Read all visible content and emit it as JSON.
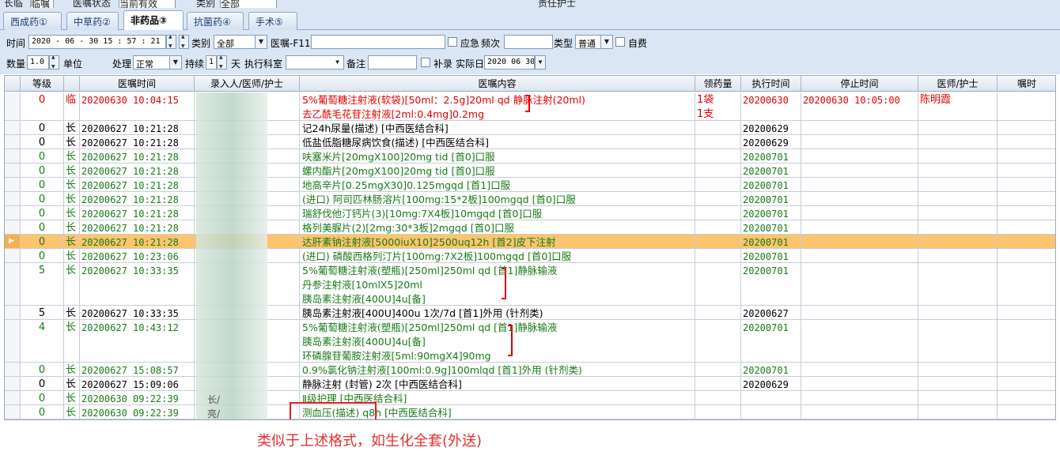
{
  "top_strip": [
    "长临",
    "临嘱",
    "医嘱状态",
    "当前有效",
    "类别",
    "全部",
    "责任护士"
  ],
  "tabs": [
    "西成药①",
    "中草药②",
    "非药品③",
    "抗菌药④",
    "手术⑤"
  ],
  "active_tab": 2,
  "toolbar": {
    "time_label": "时间",
    "time_value": "2020 - 06 - 30   15 : 57 : 21",
    "category_label": "类别",
    "category_value": "全部",
    "order_label": "医嘱-F11",
    "urgent_label": "应急",
    "freq_label": "频次",
    "type_label": "类型",
    "type_value": "普通",
    "selfpay_label": "自费",
    "qty_label": "数量",
    "qty_value": "1.0",
    "unit_label": "单位",
    "handle_label": "处理",
    "handle_value": "正常",
    "continue_label": "持续",
    "continue_value": "1",
    "days_label": "天",
    "exec_dept_label": "执行科室",
    "remark_label": "备注",
    "supp_label": "补录",
    "actual_day_label": "实际日",
    "actual_day_value": "2020 06 30"
  },
  "columns": [
    "等级",
    "医嘱时间",
    "录入人/医师/护士",
    "医嘱内容",
    "领药量",
    "执行时间",
    "停止时间",
    "医师/护士",
    "嘱时"
  ],
  "rows": [
    {
      "level": "0",
      "type": "临",
      "time": "20200630 10:04:15",
      "content": [
        "5%葡萄糖注射液(软袋)[50ml：2.5g]20ml qd 静脉注射(20ml)",
        "去乙酰毛花苷注射液[2ml:0.4mg]0.2mg"
      ],
      "qty": [
        "1袋",
        "1支"
      ],
      "exec": "20200630",
      "stop": "20200630 10:05:00",
      "doctor": "陈明霞",
      "color": "#e00000"
    },
    {
      "level": "0",
      "type": "长",
      "time": "20200627 10:21:28",
      "content": [
        "记24h尿量(描述)    [中西医结合科]"
      ],
      "qty": [],
      "exec": "20200629",
      "stop": "",
      "doctor": "",
      "color": "#000000"
    },
    {
      "level": "0",
      "type": "长",
      "time": "20200627 10:21:28",
      "content": [
        "低盐低脂糖尿病饮食(描述)    [中西医结合科]"
      ],
      "qty": [],
      "exec": "20200629",
      "stop": "",
      "doctor": "",
      "color": "#000000"
    },
    {
      "level": "0",
      "type": "长",
      "time": "20200627 10:21:28",
      "content": [
        "呋塞米片[20mgX100]20mg tid [首0]口服"
      ],
      "qty": [],
      "exec": "20200701",
      "stop": "",
      "doctor": "",
      "color": "#1a7a1a"
    },
    {
      "level": "0",
      "type": "长",
      "time": "20200627 10:21:28",
      "content": [
        "螺内酯片[20mgX100]20mg tid [首0]口服"
      ],
      "qty": [],
      "exec": "20200701",
      "stop": "",
      "doctor": "",
      "color": "#1a7a1a"
    },
    {
      "level": "0",
      "type": "长",
      "time": "20200627 10:21:28",
      "content": [
        "地高辛片[0.25mgX30]0.125mgqd [首1]口服"
      ],
      "qty": [],
      "exec": "20200701",
      "stop": "",
      "doctor": "",
      "color": "#1a7a1a"
    },
    {
      "level": "0",
      "type": "长",
      "time": "20200627 10:21:28",
      "content": [
        "(进口) 阿司匹林肠溶片[100mg:15*2板]100mgqd [首0]口服"
      ],
      "qty": [],
      "exec": "20200701",
      "stop": "",
      "doctor": "",
      "color": "#1a7a1a"
    },
    {
      "level": "0",
      "type": "长",
      "time": "20200627 10:21:28",
      "content": [
        "瑞舒伐他汀钙片(3)[10mg:7X4板]10mgqd [首0]口服"
      ],
      "qty": [],
      "exec": "20200701",
      "stop": "",
      "doctor": "",
      "color": "#1a7a1a"
    },
    {
      "level": "0",
      "type": "长",
      "time": "20200627 10:21:28",
      "content": [
        "格列美脲片(2)[2mg:30*3板]2mgqd [首0]口服"
      ],
      "qty": [],
      "exec": "20200701",
      "stop": "",
      "doctor": "",
      "color": "#1a7a1a"
    },
    {
      "level": "0",
      "type": "长",
      "time": "20200627 10:21:28",
      "content": [
        "达肝素钠注射液[5000iuX10]2500uq12h [首2]皮下注射"
      ],
      "qty": [],
      "exec": "20200701",
      "stop": "",
      "doctor": "",
      "color": "#1a7a1a",
      "selected": true
    },
    {
      "level": "0",
      "type": "长",
      "time": "20200627 10:23:06",
      "content": [
        "(进口) 磷酸西格列汀片[100mg:7X2板]100mgqd [首0]口服"
      ],
      "qty": [],
      "exec": "20200701",
      "stop": "",
      "doctor": "",
      "color": "#1a7a1a"
    },
    {
      "level": "5",
      "type": "长",
      "time": "20200627 10:33:35",
      "content": [
        "5%葡萄糖注射液(塑瓶)[250ml]250ml qd [首1]静脉输液",
        "丹参注射液[10mlX5]20ml",
        "胰岛素注射液[400U]4u[备]"
      ],
      "qty": [],
      "exec": "20200701",
      "stop": "",
      "doctor": "",
      "color": "#1a7a1a"
    },
    {
      "level": "5",
      "type": "长",
      "time": "20200627 10:33:35",
      "content": [
        "胰岛素注射液[400U]400u 1次/7d [首1]外用 (针剂类)"
      ],
      "qty": [],
      "exec": "20200627",
      "stop": "",
      "doctor": "",
      "color": "#000000"
    },
    {
      "level": "4",
      "type": "长",
      "time": "20200627 10:43:12",
      "content": [
        "5%葡萄糖注射液(塑瓶)[250ml]250ml qd [首1]静脉输液",
        "胰岛素注射液[400U]4u[备]",
        "环磷腺苷葡胺注射液[5ml:90mgX4]90mg"
      ],
      "qty": [],
      "exec": "20200701",
      "stop": "",
      "doctor": "",
      "color": "#1a7a1a"
    },
    {
      "level": "0",
      "type": "长",
      "time": "20200627 15:08:57",
      "content": [
        "0.9%氯化钠注射液[100ml:0.9g]100mlqd [首1]外用 (针剂类)"
      ],
      "qty": [],
      "exec": "20200701",
      "stop": "",
      "doctor": "",
      "color": "#1a7a1a"
    },
    {
      "level": "0",
      "type": "长",
      "time": "20200627 15:09:06",
      "content": [
        "静脉注射 (封管)    2次 [中西医结合科]"
      ],
      "qty": [],
      "exec": "20200629",
      "stop": "",
      "doctor": "",
      "color": "#000000"
    },
    {
      "level": "0",
      "type": "长",
      "time": "20200630 09:22:39",
      "content": [
        "Ⅱ级护理     [中西医结合科]"
      ],
      "qty": [],
      "exec": "",
      "stop": "",
      "doctor": "",
      "color": "#1a7a1a"
    },
    {
      "level": "0",
      "type": "长",
      "time": "20200630 09:22:39",
      "content": [
        "测血压(描述)   q8h  [中西医结合科]"
      ],
      "qty": [],
      "exec": "",
      "stop": "",
      "doctor": "",
      "color": "#1a7a1a"
    }
  ],
  "partial_recorder_text": [
    "长/",
    "亮/"
  ],
  "annotation": "类似于上述格式，如生化全套(外送)"
}
